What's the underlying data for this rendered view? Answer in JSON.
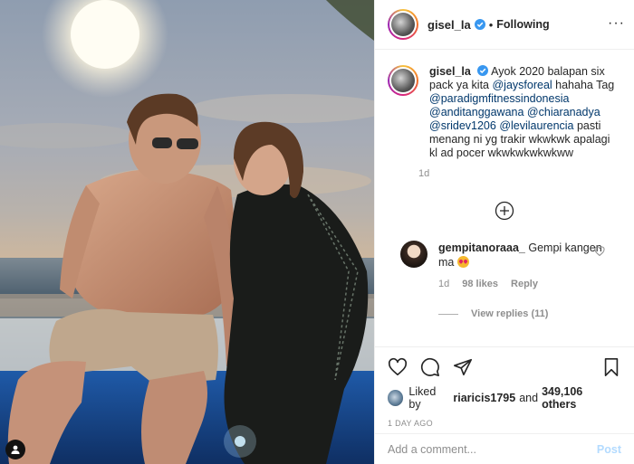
{
  "colors": {
    "link": "#00376b",
    "muted": "#8e8e8e",
    "post_disabled": "#b3dbff",
    "verified": "#3897f0"
  },
  "photo": {
    "alt": "Couple sitting by the beach at sunset",
    "user_tag_icon": "user-tag-icon"
  },
  "header": {
    "username": "gisel_la",
    "dot": "•",
    "follow_state": "Following",
    "more": "···"
  },
  "caption": {
    "username": "gisel_la",
    "parts": [
      {
        "text": "Ayok 2020 balapan six pack ya kita ",
        "mention": false
      },
      {
        "text": "@jaysforeal",
        "mention": true
      },
      {
        "text": " hahaha Tag ",
        "mention": false
      },
      {
        "text": "@paradigmfitnessindonesia",
        "mention": true
      },
      {
        "text": " ",
        "mention": false
      },
      {
        "text": "@anditanggawana",
        "mention": true
      },
      {
        "text": " ",
        "mention": false
      },
      {
        "text": "@chiaranadya",
        "mention": true
      },
      {
        "text": " ",
        "mention": false
      },
      {
        "text": "@sridev1206",
        "mention": true
      },
      {
        "text": " ",
        "mention": false
      },
      {
        "text": "@levilaurencia",
        "mention": true
      },
      {
        "text": " pasti menang ni yg trakir wkwkwk apalagi kl ad pocer wkwkwkwkwkww",
        "mention": false
      }
    ],
    "time": "1d"
  },
  "comment": {
    "username": "gempitanoraaa_",
    "text": "Gempi kangen ma",
    "time": "1d",
    "likes": "98 likes",
    "reply": "Reply",
    "view_replies": "View replies (11)"
  },
  "likes": {
    "prefix": "Liked by",
    "user": "riaricis1795",
    "and": "and",
    "count": "349,106 others"
  },
  "date": "1 DAY AGO",
  "add_comment": {
    "placeholder": "Add a comment...",
    "post": "Post"
  }
}
